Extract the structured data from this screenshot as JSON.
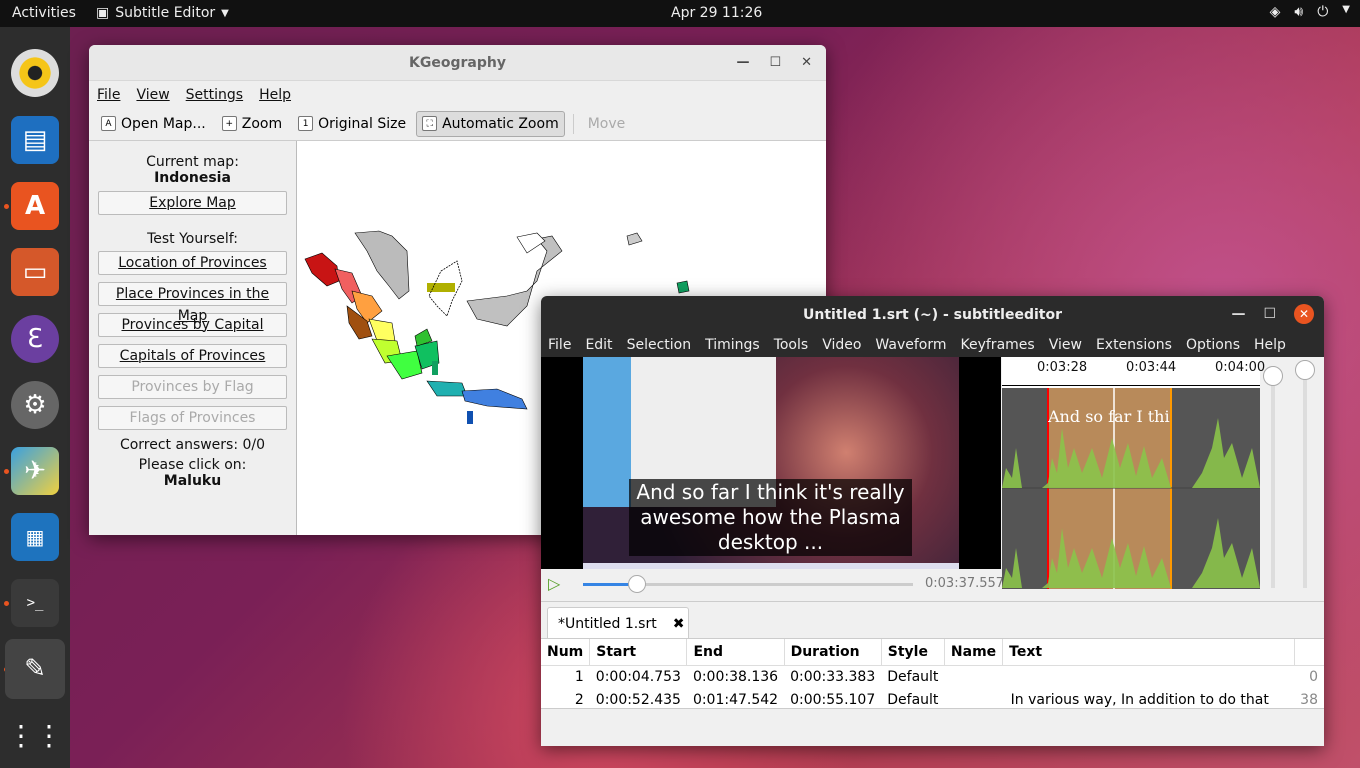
{
  "topbar": {
    "activities": "Activities",
    "app_name": "Subtitle Editor",
    "clock": "Apr 29  11:26"
  },
  "kgeography": {
    "title": "KGeography",
    "menu": [
      "File",
      "View",
      "Settings",
      "Help"
    ],
    "toolbar": {
      "open": "Open Map...",
      "zoom": "Zoom",
      "original": "Original Size",
      "auto": "Automatic Zoom",
      "move": "Move"
    },
    "current_map_label": "Current map:",
    "current_map": "Indonesia",
    "explore": "Explore Map",
    "test_label": "Test Yourself:",
    "buttons": [
      "Location of Provinces",
      "Place Provinces in the Map",
      "Provinces by Capital",
      "Capitals of Provinces"
    ],
    "disabled_buttons": [
      "Provinces by Flag",
      "Flags of Provinces"
    ],
    "correct": "Correct answers: 0/0",
    "please": "Please click on:",
    "target": "Maluku"
  },
  "subtitleeditor": {
    "title": "Untitled 1.srt (~) - subtitleeditor",
    "menu": [
      "File",
      "Edit",
      "Selection",
      "Timings",
      "Tools",
      "Video",
      "Waveform",
      "Keyframes",
      "View",
      "Extensions",
      "Options",
      "Help"
    ],
    "video_caption": "And so far I think it's really awesome how the Plasma desktop ...",
    "timecode": "0:03:37.557",
    "wave_times": [
      "0:03:28",
      "0:03:44",
      "0:04:00"
    ],
    "wave_text": "And so far I thi",
    "tab": "*Untitled 1.srt",
    "columns": [
      "Num",
      "Start",
      "End",
      "Duration",
      "Style",
      "Name",
      "Text"
    ],
    "rows": [
      {
        "num": "1",
        "start": "0:00:04.753",
        "end": "0:00:38.136",
        "duration": "0:00:33.383",
        "style": "Default",
        "name": "",
        "text": "",
        "count": "0"
      },
      {
        "num": "2",
        "start": "0:00:52.435",
        "end": "0:01:47.542",
        "duration": "0:00:55.107",
        "style": "Default",
        "name": "",
        "text": "In various way, In addition to do that",
        "count": "38"
      }
    ]
  },
  "colors": {
    "accent": "#e95420",
    "dock": "#2d2d2d",
    "waveform_green": "#8bc34a"
  }
}
